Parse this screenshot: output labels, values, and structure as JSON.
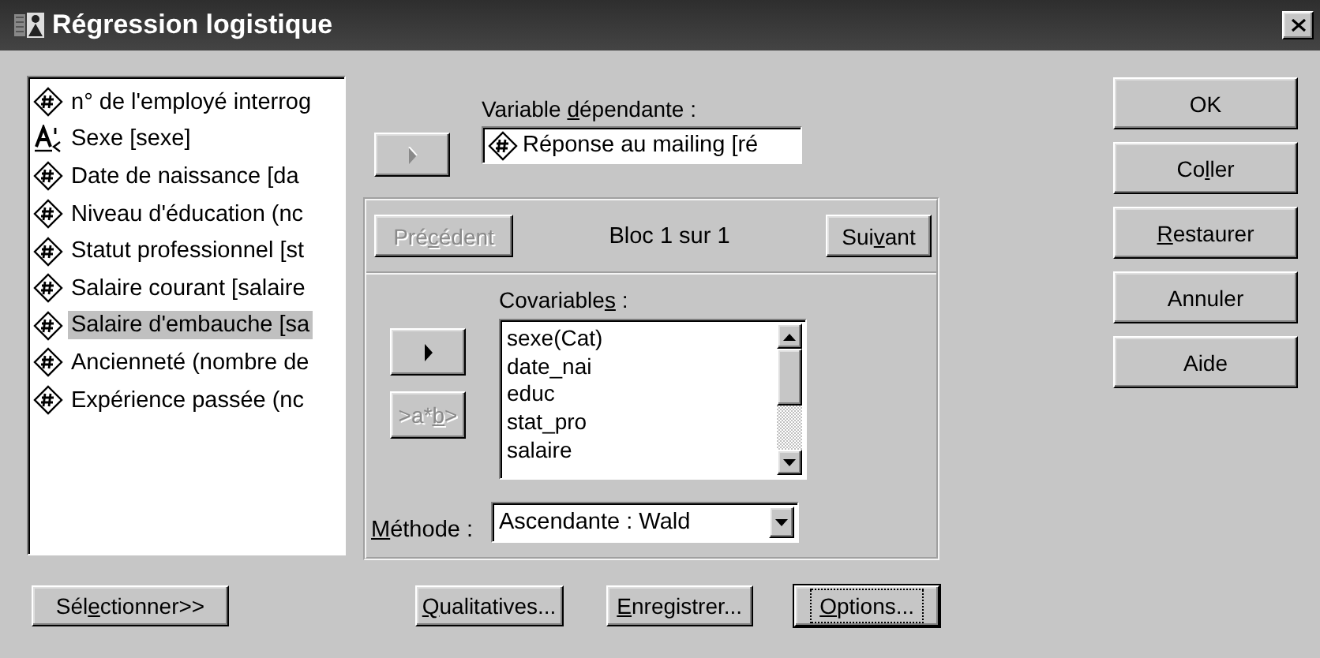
{
  "window": {
    "title": "Régression logistique"
  },
  "variables": [
    {
      "label": "n° de l'employé interrog",
      "kind": "numeric",
      "selected": false
    },
    {
      "label": "Sexe [sexe]",
      "kind": "string",
      "selected": false
    },
    {
      "label": "Date de naissance [da",
      "kind": "numeric",
      "selected": false
    },
    {
      "label": "Niveau d'éducation (nc",
      "kind": "numeric",
      "selected": false
    },
    {
      "label": "Statut professionnel [st",
      "kind": "numeric",
      "selected": false
    },
    {
      "label": "Salaire courant [salaire",
      "kind": "numeric",
      "selected": false
    },
    {
      "label": "Salaire d'embauche [sa",
      "kind": "numeric",
      "selected": true
    },
    {
      "label": "Ancienneté (nombre de",
      "kind": "numeric",
      "selected": false
    },
    {
      "label": "Expérience passée (nc",
      "kind": "numeric",
      "selected": false
    }
  ],
  "select_button": {
    "label": {
      "before": "Sél",
      "key": "e",
      "after": "ctionner>>"
    }
  },
  "dependent": {
    "add_button": {
      "disabled": true
    },
    "label": {
      "before": "Variable ",
      "key": "d",
      "after": "épendante :"
    },
    "value": "Réponse au mailing [ré",
    "kind": "numeric"
  },
  "block": {
    "previous": {
      "label": {
        "before": "Pré",
        "key": "c",
        "after": "édent"
      },
      "disabled": true
    },
    "status": "Bloc 1 sur 1",
    "next": {
      "label": {
        "before": "Sui",
        "key": "v",
        "after": "ant"
      },
      "disabled": false
    }
  },
  "covariates": {
    "label": {
      "before": "Covariable",
      "key": "s",
      "after": " :"
    },
    "add_button": {
      "disabled": false
    },
    "interaction_button": {
      "label": {
        "before": ">a*",
        "key": "b",
        "after": ">"
      },
      "disabled": true
    },
    "items": [
      "sexe(Cat)",
      "date_nai",
      "educ",
      "stat_pro",
      "salaire"
    ]
  },
  "method": {
    "label": {
      "key": "M",
      "after": "éthode :"
    },
    "value": "Ascendante : Wald"
  },
  "bottom_buttons": [
    {
      "label": {
        "key": "Q",
        "after": "ualitatives..."
      },
      "default": false
    },
    {
      "label": {
        "key": "E",
        "after": "nregistrer..."
      },
      "default": false
    },
    {
      "label": {
        "key": "O",
        "after": "ptions..."
      },
      "default": true
    }
  ],
  "side_buttons": [
    {
      "label": "OK"
    },
    {
      "label": {
        "before": "Co",
        "key": "l",
        "after": "ler"
      }
    },
    {
      "label": {
        "key": "R",
        "after": "estaurer"
      }
    },
    {
      "label": "Annuler"
    },
    {
      "label": "Aide"
    }
  ]
}
